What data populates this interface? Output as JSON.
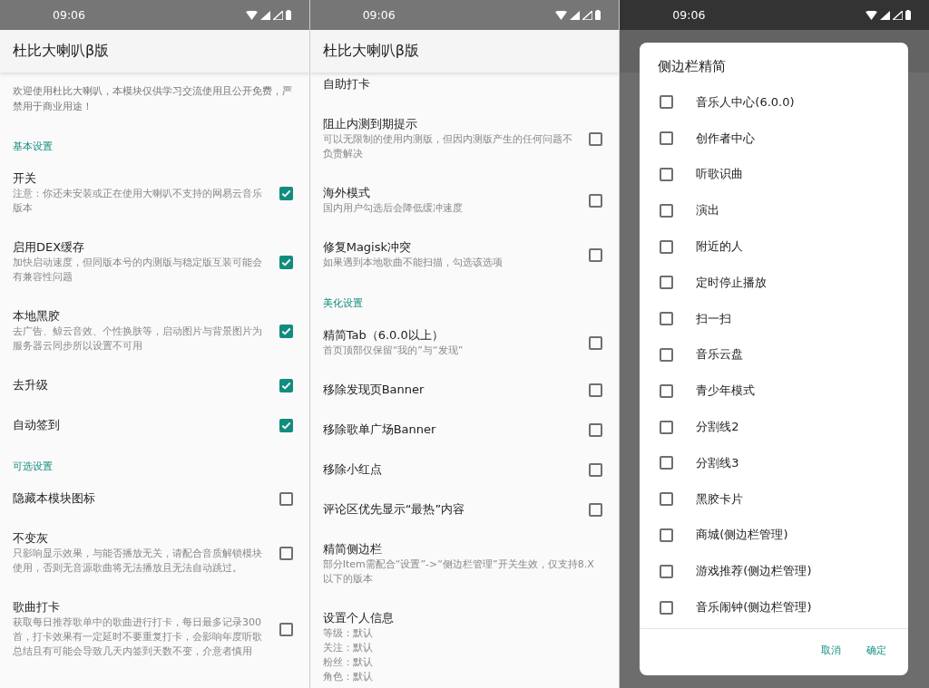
{
  "panels": [
    {
      "status_time": "09:06",
      "title": "杜比大喇叭β版",
      "items": [
        {
          "kind": "note",
          "text": "欢迎使用杜比大喇叭，本模块仅供学习交流使用且公开免费，严禁用于商业用途！"
        },
        {
          "kind": "header",
          "text": "基本设置"
        },
        {
          "kind": "check",
          "title": "开关",
          "summary": "注意：你还未安装或正在使用大喇叭不支持的网易云音乐版本",
          "checked": true
        },
        {
          "kind": "check",
          "title": "启用DEX缓存",
          "summary": "加快启动速度，但同版本号的内测版与稳定版互装可能会有兼容性问题",
          "checked": true
        },
        {
          "kind": "check",
          "title": "本地黑胶",
          "summary": "去广告、鲸云音效、个性换肤等，启动图片与背景图片为服务器云同步所以设置不可用",
          "checked": true
        },
        {
          "kind": "check",
          "title": "去升级",
          "checked": true
        },
        {
          "kind": "check",
          "title": "自动签到",
          "checked": true
        },
        {
          "kind": "header",
          "text": "可选设置"
        },
        {
          "kind": "check",
          "title": "隐藏本模块图标",
          "checked": false
        },
        {
          "kind": "check",
          "title": "不变灰",
          "summary": "只影响显示效果，与能否播放无关，请配合音质解锁模块使用，否则无音源歌曲将无法播放且无法自动跳过。",
          "checked": false
        },
        {
          "kind": "check",
          "title": "歌曲打卡",
          "summary": "获取每日推荐歌单中的歌曲进行打卡，每日最多记录300首，打卡效果有一定延时不要重复打卡，会影响年度听歌总结且有可能会导致几天内签到天数不变，介意者慎用",
          "checked": false
        }
      ]
    },
    {
      "status_time": "09:06",
      "title": "杜比大喇叭β版",
      "items": [
        {
          "kind": "plain",
          "title": "自助打卡"
        },
        {
          "kind": "check",
          "title": "阻止内测到期提示",
          "summary": "可以无限制的使用内测版，但因内测版产生的任何问题不负责解决",
          "checked": false
        },
        {
          "kind": "check",
          "title": "海外模式",
          "summary": "国内用户勾选后会降低缓冲速度",
          "checked": false
        },
        {
          "kind": "check",
          "title": "修复Magisk冲突",
          "summary": "如果遇到本地歌曲不能扫描，勾选该选项",
          "checked": false
        },
        {
          "kind": "header",
          "text": "美化设置"
        },
        {
          "kind": "check",
          "title": "精简Tab（6.0.0以上）",
          "summary": "首页顶部仅保留“我的”与“发现”",
          "checked": false
        },
        {
          "kind": "check",
          "title": "移除发现页Banner",
          "checked": false
        },
        {
          "kind": "check",
          "title": "移除歌单广场Banner",
          "checked": false
        },
        {
          "kind": "check",
          "title": "移除小红点",
          "checked": false
        },
        {
          "kind": "check",
          "title": "评论区优先显示“最热”内容",
          "checked": false
        },
        {
          "kind": "plain",
          "title": "精简侧边栏",
          "summary": "部分Item需配合“设置”->“侧边栏管理”开关生效，仅支持8.X以下的版本"
        },
        {
          "kind": "plain",
          "title": "设置个人信息",
          "lines": [
            "等级：默认",
            "关注：默认",
            "粉丝：默认",
            "角色：默认"
          ]
        }
      ]
    },
    {
      "status_time": "09:06",
      "dialog": {
        "title": "侧边栏精简",
        "options": [
          {
            "label": "音乐人中心(6.0.0)",
            "checked": false
          },
          {
            "label": "创作者中心",
            "checked": false
          },
          {
            "label": "听歌识曲",
            "checked": false
          },
          {
            "label": "演出",
            "checked": false
          },
          {
            "label": "附近的人",
            "checked": false
          },
          {
            "label": "定时停止播放",
            "checked": false
          },
          {
            "label": "扫一扫",
            "checked": false
          },
          {
            "label": "音乐云盘",
            "checked": false
          },
          {
            "label": "青少年模式",
            "checked": false
          },
          {
            "label": "分割线2",
            "checked": false
          },
          {
            "label": "分割线3",
            "checked": false
          },
          {
            "label": "黑胶卡片",
            "checked": false
          },
          {
            "label": "商城(侧边栏管理)",
            "checked": false
          },
          {
            "label": "游戏推荐(侧边栏管理)",
            "checked": false
          },
          {
            "label": "音乐闹钟(侧边栏管理)",
            "checked": false
          }
        ],
        "buttons": [
          "取消",
          "确定"
        ]
      }
    }
  ]
}
